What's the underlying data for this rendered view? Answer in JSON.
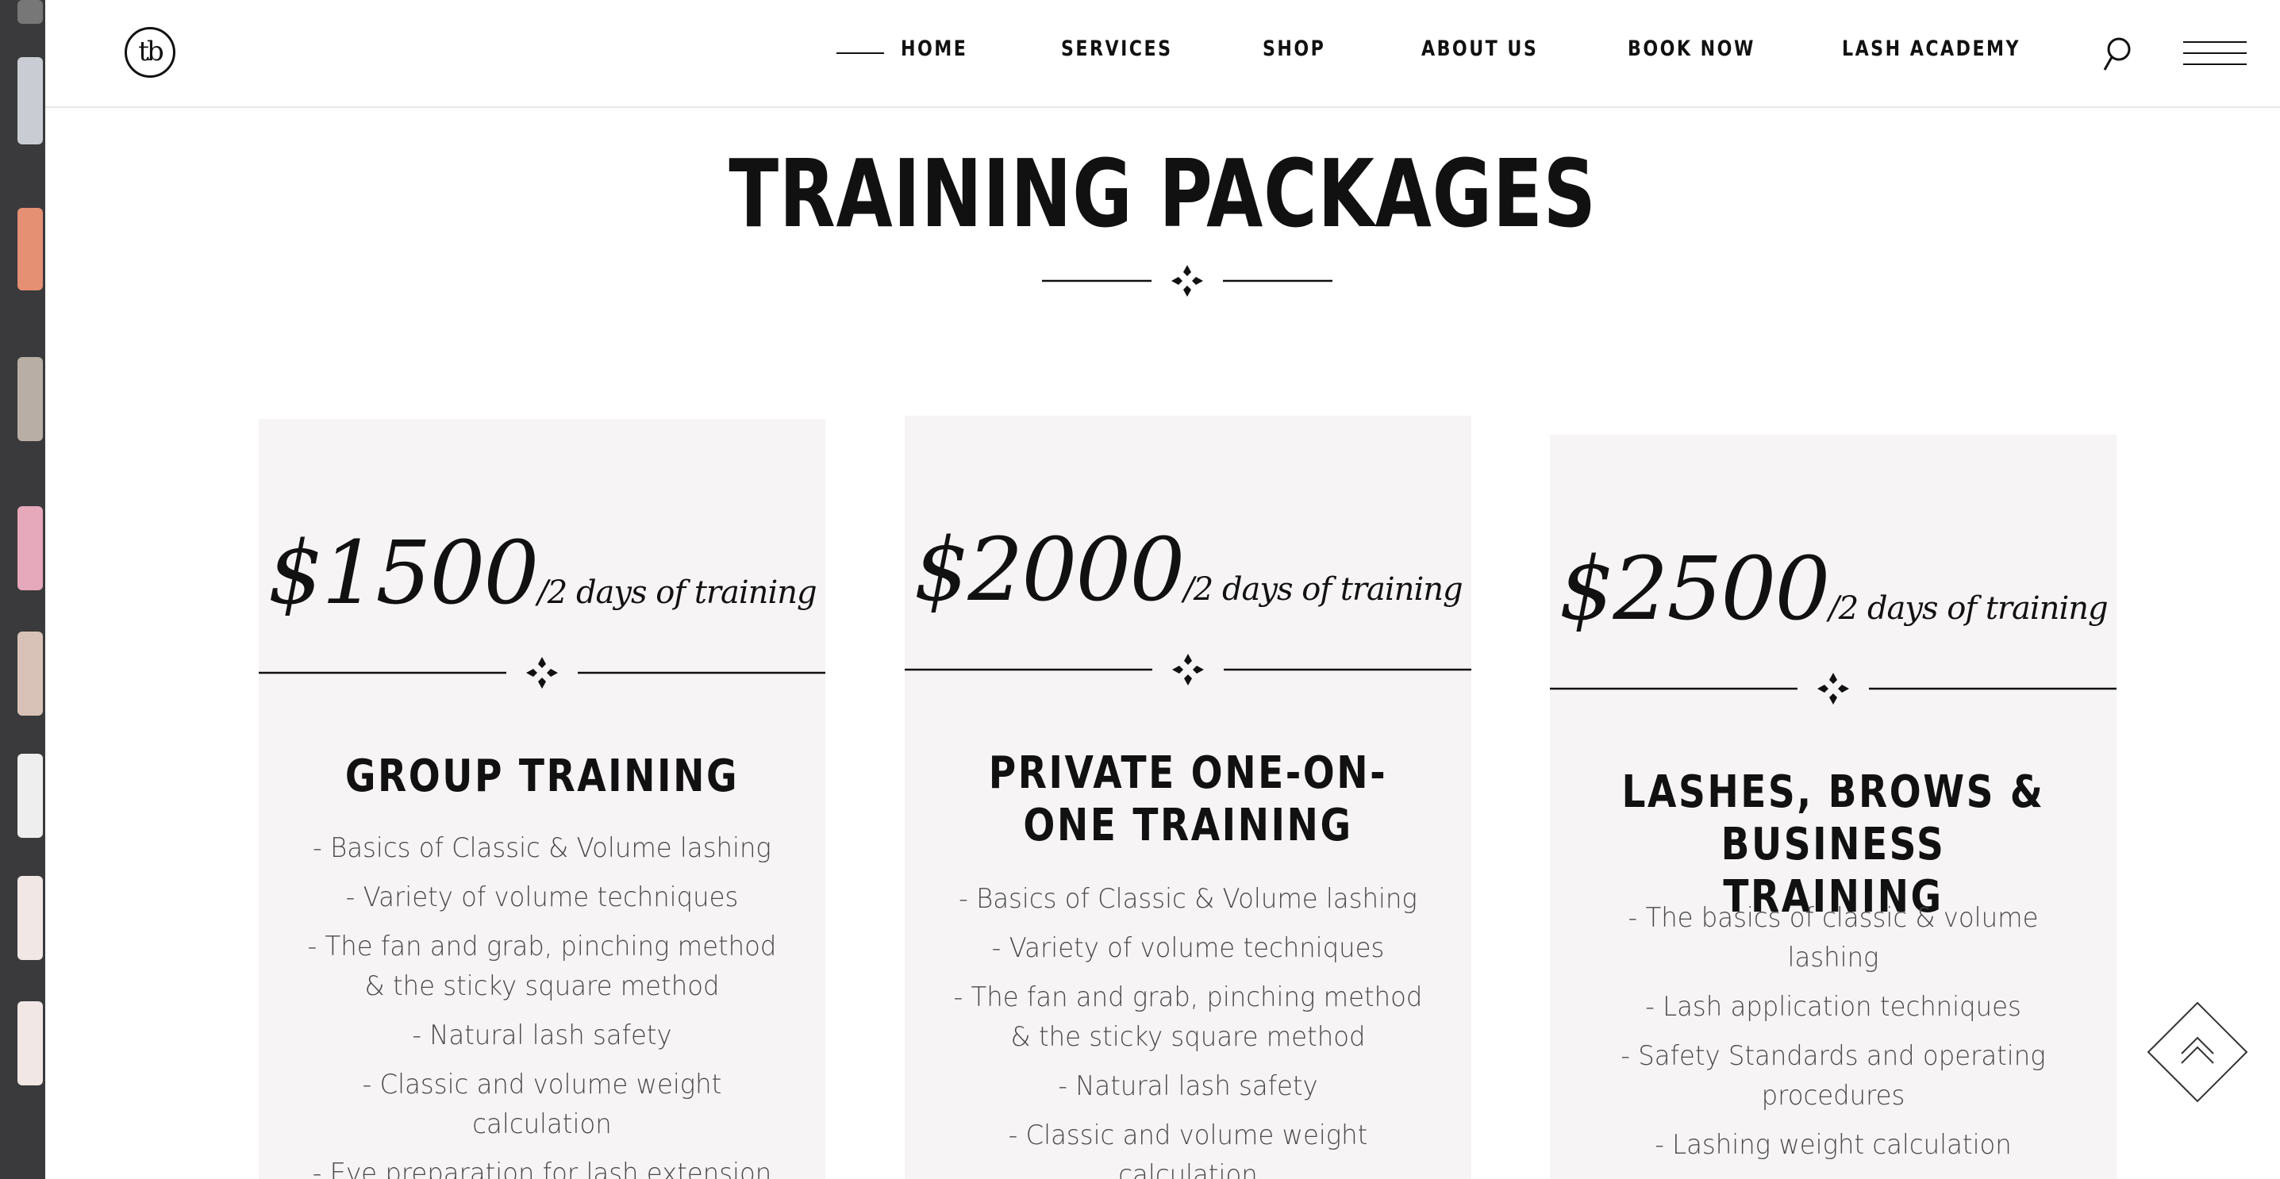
{
  "header": {
    "logo_text": "tb",
    "nav": [
      {
        "label": "HOME"
      },
      {
        "label": "SERVICES"
      },
      {
        "label": "SHOP"
      },
      {
        "label": "ABOUT US"
      },
      {
        "label": "BOOK NOW"
      },
      {
        "label": "LASH ACADEMY"
      }
    ],
    "search_icon": "search-icon",
    "menu_icon": "hamburger-menu-icon"
  },
  "section": {
    "title": "TRAINING PACKAGES",
    "divider_icon": "diamond-ornament-icon"
  },
  "cards": [
    {
      "price": "$1500",
      "price_note": "/2 days of training",
      "title": "GROUP TRAINING",
      "features": [
        "- Basics of Classic & Volume lashing",
        "- Variety of volume techniques",
        "- The fan and grab, pinching method & the sticky square method",
        "- Natural lash safety",
        "- Classic and volume weight calculation",
        "- Eye preparation for lash extension"
      ]
    },
    {
      "price": "$2000",
      "price_note": "/2 days of training",
      "title": "PRIVATE ONE-ON-ONE TRAINING",
      "features": [
        "- Basics of Classic & Volume lashing",
        "- Variety of volume techniques",
        "- The fan and grab, pinching method & the sticky square method",
        "- Natural lash safety",
        "- Classic and volume weight calculation"
      ]
    },
    {
      "price": "$2500",
      "price_note": "/2 days of training",
      "title": "LASHES, BROWS & BUSINESS TRAINING",
      "features": [
        "- The basics of classic & volume lashing",
        "- Lash application techniques",
        "- Safety Standards and operating procedures",
        "- Lashing weight calculation"
      ]
    }
  ],
  "scroll_top_icon": "chevron-up-icon"
}
